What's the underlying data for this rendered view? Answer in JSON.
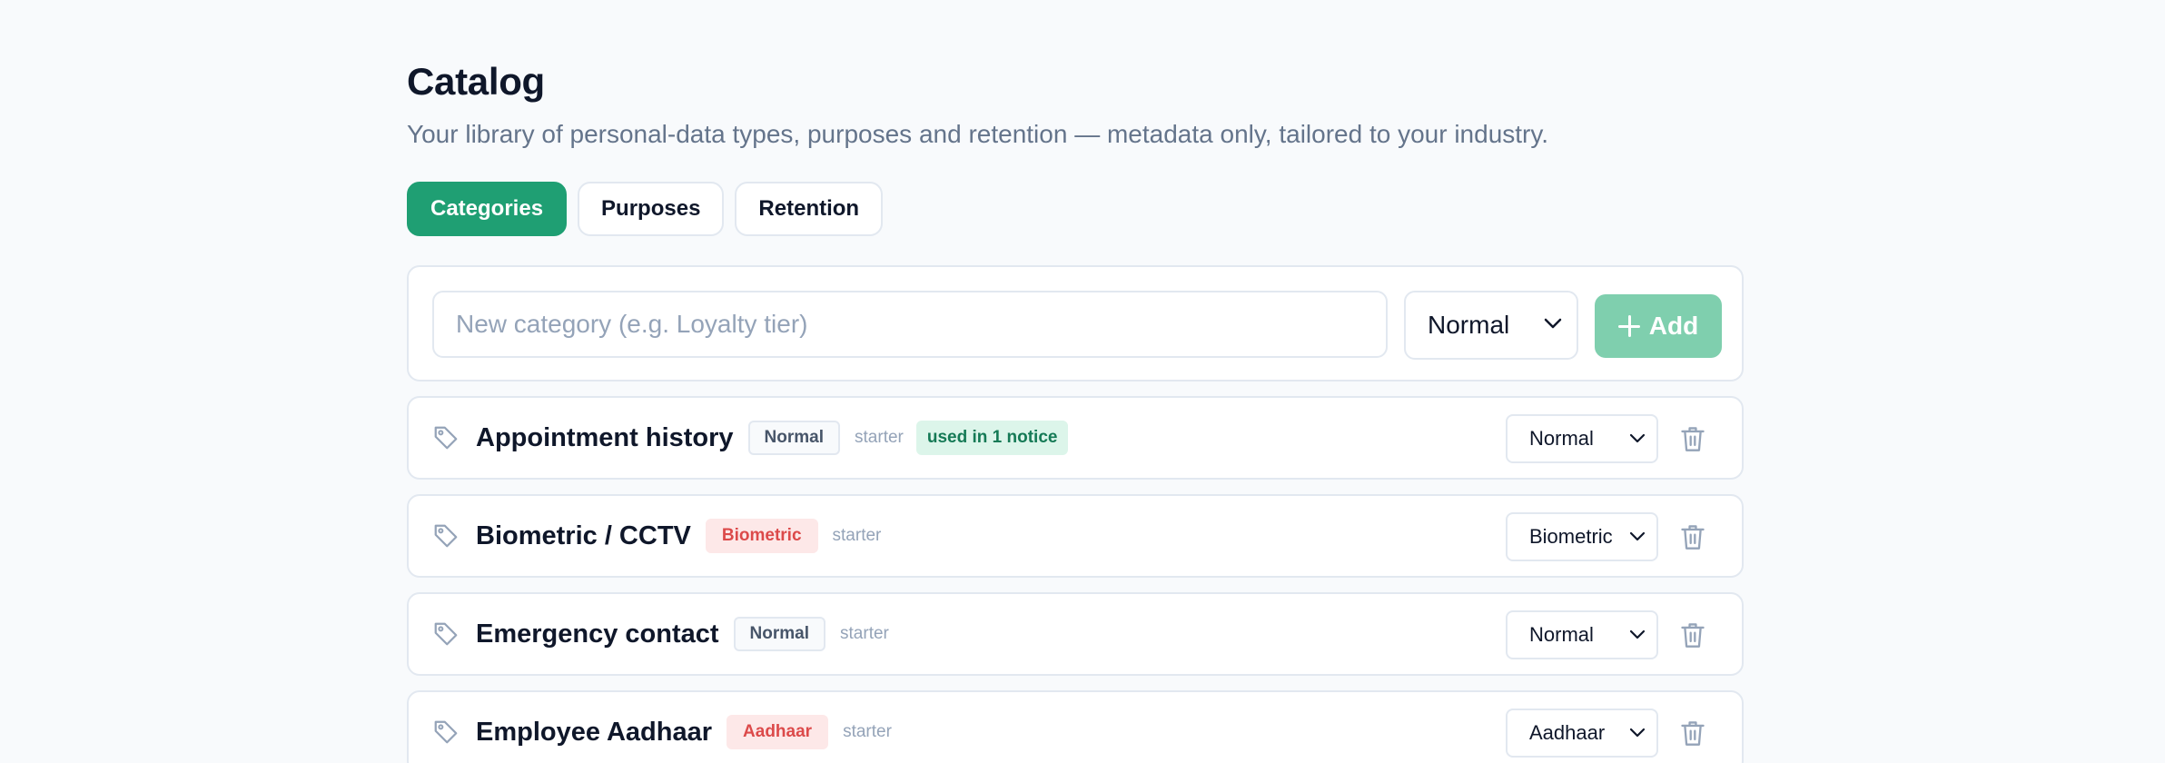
{
  "page": {
    "title": "Catalog",
    "subtitle": "Your library of personal-data types, purposes and retention — metadata only, tailored to your industry."
  },
  "tabs": [
    {
      "label": "Categories",
      "active": true
    },
    {
      "label": "Purposes",
      "active": false
    },
    {
      "label": "Retention",
      "active": false
    }
  ],
  "add_form": {
    "placeholder": "New category (e.g. Loyalty tier)",
    "value": "",
    "sensitivity_selected": "Normal",
    "add_label": "Add",
    "add_icon": "plus-icon"
  },
  "categories": [
    {
      "name": "Appointment history",
      "badge": "Normal",
      "badge_kind": "normal",
      "source": "starter",
      "usage": "used in 1 notice",
      "select_value": "Normal",
      "icon": "tag-icon",
      "delete_icon": "trash-icon"
    },
    {
      "name": "Biometric / CCTV",
      "badge": "Biometric",
      "badge_kind": "special",
      "source": "starter",
      "usage": "",
      "select_value": "Biometric",
      "icon": "tag-icon",
      "delete_icon": "trash-icon"
    },
    {
      "name": "Emergency contact",
      "badge": "Normal",
      "badge_kind": "normal",
      "source": "starter",
      "usage": "",
      "select_value": "Normal",
      "icon": "tag-icon",
      "delete_icon": "trash-icon"
    },
    {
      "name": "Employee Aadhaar",
      "badge": "Aadhaar",
      "badge_kind": "special",
      "source": "starter",
      "usage": "",
      "select_value": "Aadhaar",
      "icon": "tag-icon",
      "delete_icon": "trash-icon"
    }
  ],
  "colors": {
    "accent": "#1f9f73",
    "accent_disabled": "#7fcfae",
    "special_badge_bg": "#fde8e8",
    "special_badge_text": "#dc4a4a",
    "usage_bg": "#dcf5ea",
    "usage_text": "#157a56"
  }
}
